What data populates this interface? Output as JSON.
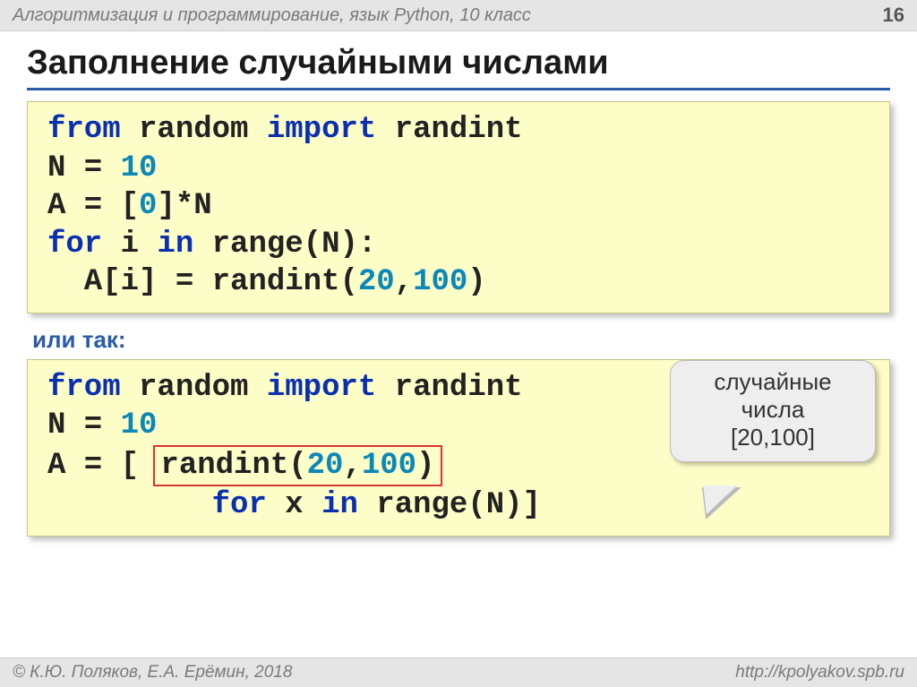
{
  "header": {
    "course": "Алгоритмизация и программирование, язык Python, 10 класс",
    "page": "16"
  },
  "title": "Заполнение случайными числами",
  "code1": {
    "l1": {
      "kw1": "from",
      "sp1": " random ",
      "kw2": "import",
      "sp2": " randint"
    },
    "l2": {
      "t1": "N = ",
      "n1": "10"
    },
    "l3": {
      "t1": "A = [",
      "n1": "0",
      "t2": "]*N"
    },
    "l4": {
      "kw1": "for",
      "t1": " i ",
      "kw2": "in",
      "t2": " range(N):"
    },
    "l5": {
      "t1": "  A[i] = randint(",
      "n1": "20",
      "t2": ",",
      "n2": "100",
      "t3": ")"
    }
  },
  "subtitle": "или так:",
  "code2": {
    "l1": {
      "kw1": "from",
      "sp1": " random ",
      "kw2": "import",
      "sp2": " randint"
    },
    "l2": {
      "t1": "N = ",
      "n1": "10"
    },
    "l3": {
      "t1": "A = [ ",
      "hl_t1": "randint(",
      "hl_n1": "20",
      "hl_t2": ",",
      "hl_n2": "100",
      "hl_t3": ")"
    },
    "l4": {
      "pad": "         ",
      "kw1": "for",
      "t1": " x ",
      "kw2": "in",
      "t2": " range(N)]"
    }
  },
  "callout": {
    "l1": "случайные",
    "l2": "числа",
    "l3": "[20,100]"
  },
  "footer": {
    "copy": "© К.Ю. Поляков, Е.А. Ерёмин, 2018",
    "url": "http://kpolyakov.spb.ru"
  }
}
